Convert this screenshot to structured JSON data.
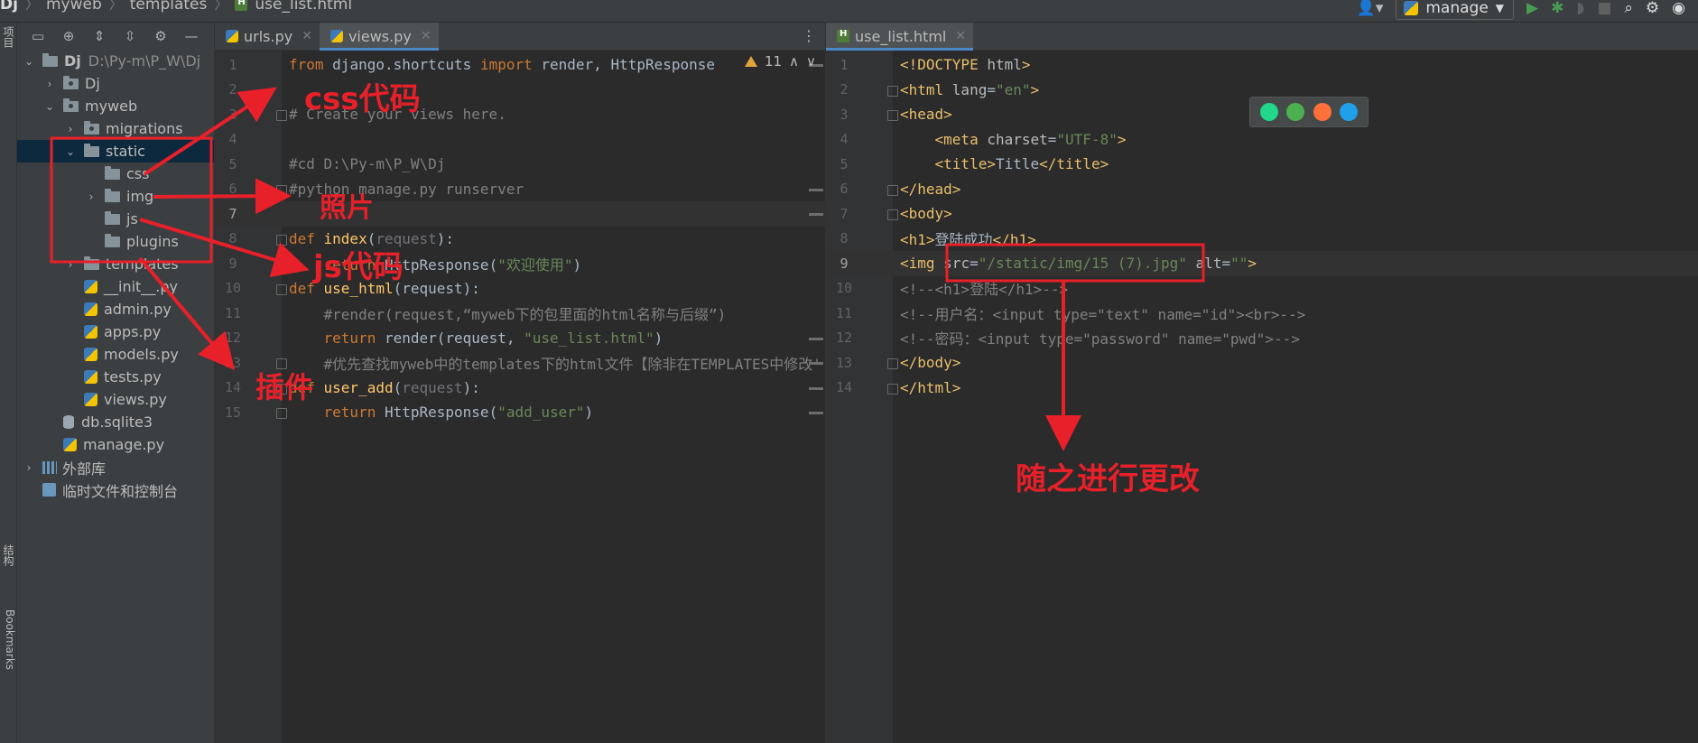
{
  "breadcrumb": [
    "Dj",
    "myweb",
    "templates",
    "use_list.html"
  ],
  "run_config": {
    "label": "manage"
  },
  "left_stripe": {
    "top_label": "项目",
    "mid_label": "结构",
    "bottom_label": "Bookmarks"
  },
  "project_tree": [
    {
      "label": "Dj",
      "secondary": "D:\\Py-m\\P_W\\Dj",
      "icon": "folder",
      "depth": 0,
      "chevron": "open",
      "bold": true
    },
    {
      "label": "Dj",
      "icon": "folder-dot",
      "depth": 1,
      "chevron": "closed"
    },
    {
      "label": "myweb",
      "icon": "folder-dot",
      "depth": 1,
      "chevron": "open"
    },
    {
      "label": "migrations",
      "icon": "folder-dot",
      "depth": 2,
      "chevron": "closed"
    },
    {
      "label": "static",
      "icon": "folder",
      "depth": 2,
      "chevron": "open",
      "selected": true
    },
    {
      "label": "css",
      "icon": "folder",
      "depth": 3,
      "chevron": "none"
    },
    {
      "label": "img",
      "icon": "folder",
      "depth": 3,
      "chevron": "closed"
    },
    {
      "label": "js",
      "icon": "folder",
      "depth": 3,
      "chevron": "none"
    },
    {
      "label": "plugins",
      "icon": "folder",
      "depth": 3,
      "chevron": "none"
    },
    {
      "label": "templates",
      "icon": "folder",
      "depth": 2,
      "chevron": "closed"
    },
    {
      "label": "__init__.py",
      "icon": "python",
      "depth": 2,
      "chevron": "none"
    },
    {
      "label": "admin.py",
      "icon": "python",
      "depth": 2,
      "chevron": "none"
    },
    {
      "label": "apps.py",
      "icon": "python",
      "depth": 2,
      "chevron": "none"
    },
    {
      "label": "models.py",
      "icon": "python",
      "depth": 2,
      "chevron": "none"
    },
    {
      "label": "tests.py",
      "icon": "python",
      "depth": 2,
      "chevron": "none"
    },
    {
      "label": "views.py",
      "icon": "python",
      "depth": 2,
      "chevron": "none"
    },
    {
      "label": "db.sqlite3",
      "icon": "database",
      "depth": 1,
      "chevron": "none"
    },
    {
      "label": "manage.py",
      "icon": "python",
      "depth": 1,
      "chevron": "none"
    },
    {
      "label": "外部库",
      "icon": "library",
      "depth": 0,
      "chevron": "closed"
    },
    {
      "label": "临时文件和控制台",
      "icon": "scratch",
      "depth": 0,
      "chevron": "none"
    }
  ],
  "left_editor": {
    "tabs": [
      {
        "label": "urls.py",
        "icon": "python-icon",
        "active": false
      },
      {
        "label": "views.py",
        "icon": "python-icon",
        "active": true
      }
    ],
    "inspection": {
      "warnings": "11"
    },
    "current_line": 7,
    "lines": [
      [
        [
          "kw",
          "from "
        ],
        [
          "txt",
          "django.shortcuts "
        ],
        [
          "kw",
          "import "
        ],
        [
          "txt",
          "render, HttpResponse"
        ]
      ],
      [],
      [
        [
          "cmt",
          "# Create your views here."
        ]
      ],
      [],
      [
        [
          "cmt",
          "#cd D:\\Py-m\\P_W\\Dj"
        ]
      ],
      [
        [
          "cmt",
          "#python manage.py runserver"
        ]
      ],
      [],
      [
        [
          "kw",
          "def "
        ],
        [
          "fn",
          "index"
        ],
        [
          "txt",
          "("
        ],
        [
          "param",
          "request"
        ],
        [
          "txt",
          "):"
        ]
      ],
      [
        [
          "txt",
          "    "
        ],
        [
          "kw",
          "return "
        ],
        [
          "txt",
          "HttpResponse("
        ],
        [
          "str",
          "\"欢迎使用\""
        ],
        [
          "txt",
          ")"
        ]
      ],
      [
        [
          "kw",
          "def "
        ],
        [
          "fn",
          "use_html"
        ],
        [
          "txt",
          "(request):"
        ]
      ],
      [
        [
          "txt",
          "    "
        ],
        [
          "cmt",
          "#render(request,“myweb下的包里面的html名称与后缀”)"
        ]
      ],
      [
        [
          "txt",
          "    "
        ],
        [
          "kw",
          "return "
        ],
        [
          "txt",
          "render(request, "
        ],
        [
          "str",
          "\"use_list.html\""
        ],
        [
          "txt",
          ")"
        ]
      ],
      [
        [
          "txt",
          "    "
        ],
        [
          "cmt",
          "#优先查找myweb中的templates下的html文件【除非在TEMPLATES中修改'"
        ]
      ],
      [
        [
          "kw",
          "def "
        ],
        [
          "fn",
          "user_add"
        ],
        [
          "txt",
          "("
        ],
        [
          "param",
          "request"
        ],
        [
          "txt",
          "):"
        ]
      ],
      [
        [
          "txt",
          "    "
        ],
        [
          "kw",
          "return "
        ],
        [
          "txt",
          "HttpResponse("
        ],
        [
          "str",
          "\"add_user\""
        ],
        [
          "txt",
          ")"
        ]
      ]
    ]
  },
  "right_editor": {
    "tabs": [
      {
        "label": "use_list.html",
        "icon": "html-icon",
        "active": true
      }
    ],
    "current_line": 9,
    "lines": [
      [
        [
          "tag",
          "<!DOCTYPE "
        ],
        [
          "attr",
          "html"
        ],
        [
          "tag",
          ">"
        ]
      ],
      [
        [
          "tag",
          "<html "
        ],
        [
          "attr",
          "lang"
        ],
        [
          "txt",
          "="
        ],
        [
          "str",
          "\"en\""
        ],
        [
          "tag",
          ">"
        ]
      ],
      [
        [
          "tag",
          "<head>"
        ]
      ],
      [
        [
          "txt",
          "    "
        ],
        [
          "tag",
          "<meta "
        ],
        [
          "attr",
          "charset"
        ],
        [
          "txt",
          "="
        ],
        [
          "str",
          "\"UTF-8\""
        ],
        [
          "tag",
          ">"
        ]
      ],
      [
        [
          "txt",
          "    "
        ],
        [
          "tag",
          "<title>"
        ],
        [
          "txt",
          "Title"
        ],
        [
          "tag",
          "</title>"
        ]
      ],
      [
        [
          "tag",
          "</head>"
        ]
      ],
      [
        [
          "tag",
          "<body>"
        ]
      ],
      [
        [
          "tag",
          "<h1>"
        ],
        [
          "txt",
          "登陆成功"
        ],
        [
          "tag",
          "</h1>"
        ]
      ],
      [
        [
          "tag",
          "<img "
        ],
        [
          "attr",
          "src"
        ],
        [
          "txt",
          "="
        ],
        [
          "str",
          "\"/static/img/15 (7).jpg\""
        ],
        [
          "txt",
          " "
        ],
        [
          "attr",
          "alt"
        ],
        [
          "txt",
          "="
        ],
        [
          "str",
          "\"\""
        ],
        [
          "tag",
          ">"
        ]
      ],
      [
        [
          "cmt",
          "<!--<h1>登陆</h1>-->"
        ]
      ],
      [
        [
          "cmt",
          "<!--用户名：<input type=\"text\" name=\"id\"><br>-->"
        ]
      ],
      [
        [
          "cmt",
          "<!--密码：<input type=\"password\" name=\"pwd\">-->"
        ]
      ],
      [
        [
          "tag",
          "</body>"
        ]
      ],
      [
        [
          "tag",
          "</html>"
        ]
      ]
    ]
  },
  "browser_popup": [
    {
      "name": "pycharm-icon",
      "color": "#21d789"
    },
    {
      "name": "chrome-icon",
      "color": "#4caf50"
    },
    {
      "name": "firefox-icon",
      "color": "#ff7139"
    },
    {
      "name": "edge-icon",
      "color": "#1fa0e8"
    }
  ],
  "annotations": {
    "css": "css代码",
    "img": "照片",
    "js": "js代码",
    "plugins": "插件",
    "change": "随之进行更改",
    "color": "#e8202a"
  }
}
